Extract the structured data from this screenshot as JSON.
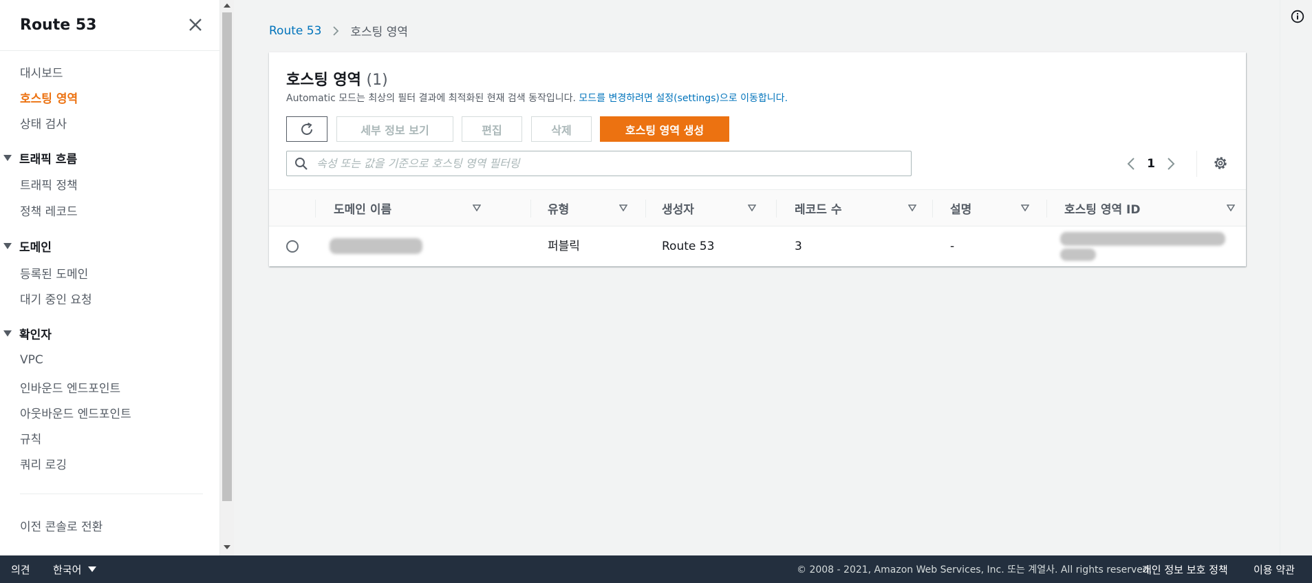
{
  "sidebar": {
    "title": "Route 53",
    "items": {
      "dashboard": "대시보드",
      "hosted_zones": "호스팅 영역",
      "health_checks": "상태 검사",
      "traffic_flow": "트래픽 흐름",
      "traffic_policies": "트래픽 정책",
      "policy_records": "정책 레코드",
      "domains": "도메인",
      "registered_domains": "등록된 도메인",
      "pending_requests": "대기 중인 요청",
      "resolver": "확인자",
      "vpc": "VPC",
      "inbound_endpoints": "인바운드 엔드포인트",
      "outbound_endpoints": "아웃바운드 엔드포인트",
      "rules": "규칙",
      "query_logging": "쿼리 로깅",
      "switch_console": "이전 콘솔로 전환"
    }
  },
  "breadcrumb": {
    "root": "Route 53",
    "current": "호스팅 영역"
  },
  "panel": {
    "title": "호스팅 영역",
    "count": "(1)",
    "desc_prefix": "Automatic 모드는 최상의 필터 결과에 최적화된 현재 검색 동작입니다.",
    "desc_link": "모드를 변경하려면 설정(settings)으로 이동합니다."
  },
  "toolbar": {
    "details": "세부 정보 보기",
    "edit": "편집",
    "delete": "삭제",
    "create": "호스팅 영역 생성"
  },
  "search": {
    "placeholder": "속성 또는 값을 기준으로 호스팅 영역 필터링"
  },
  "pagination": {
    "page": "1"
  },
  "table": {
    "columns": {
      "domain": "도메인 이름",
      "type": "유형",
      "creator": "생성자",
      "records": "레코드 수",
      "description": "설명",
      "zone_id": "호스팅 영역 ID"
    },
    "rows": [
      {
        "type": "퍼블릭",
        "creator": "Route 53",
        "records": "3",
        "description": "-"
      }
    ]
  },
  "footer": {
    "feedback": "의견",
    "language": "한국어",
    "copyright": "© 2008 - 2021, Amazon Web Services, Inc. 또는 계열사. All rights reserved.",
    "privacy": "개인 정보 보호 정책",
    "terms": "이용 약관"
  },
  "colors": {
    "accent": "#ec7211",
    "link": "#0073bb",
    "footer_bg": "#232f3e"
  }
}
